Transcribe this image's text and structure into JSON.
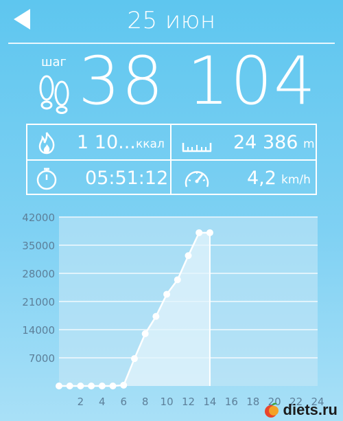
{
  "header": {
    "title": "25 июн"
  },
  "steps": {
    "label": "шаг",
    "value": "38 104"
  },
  "stats": {
    "calories": {
      "value": "1 10...",
      "unit": "ккал",
      "icon": "fire-icon"
    },
    "distance": {
      "value": "24 386",
      "unit": "m",
      "icon": "ruler-icon"
    },
    "duration": {
      "value": "05:51:12",
      "icon": "stopwatch-icon"
    },
    "speed": {
      "value": "4,2",
      "unit": "km/h",
      "icon": "speedometer-icon"
    }
  },
  "chart_data": {
    "type": "area",
    "x": [
      0,
      1,
      2,
      3,
      4,
      5,
      6,
      7,
      8,
      9,
      10,
      11,
      12,
      13,
      14
    ],
    "values": [
      0,
      0,
      0,
      0,
      0,
      0,
      200,
      6800,
      13000,
      17300,
      22800,
      26400,
      32400,
      38100,
      38104
    ],
    "x_ticks": [
      "2",
      "4",
      "6",
      "8",
      "10",
      "12",
      "14",
      "16",
      "18",
      "20",
      "22",
      "24"
    ],
    "y_ticks": [
      "7000",
      "14000",
      "21000",
      "28000",
      "35000",
      "42000"
    ],
    "ylim": [
      0,
      42000
    ],
    "xlim": [
      0,
      24
    ]
  },
  "watermark": {
    "text": "diets.ru"
  },
  "colors": {
    "background": "#5ec6ef",
    "chart_fill": "#c6e7f6",
    "line": "#ffffff",
    "tick": "#5c7f99"
  }
}
